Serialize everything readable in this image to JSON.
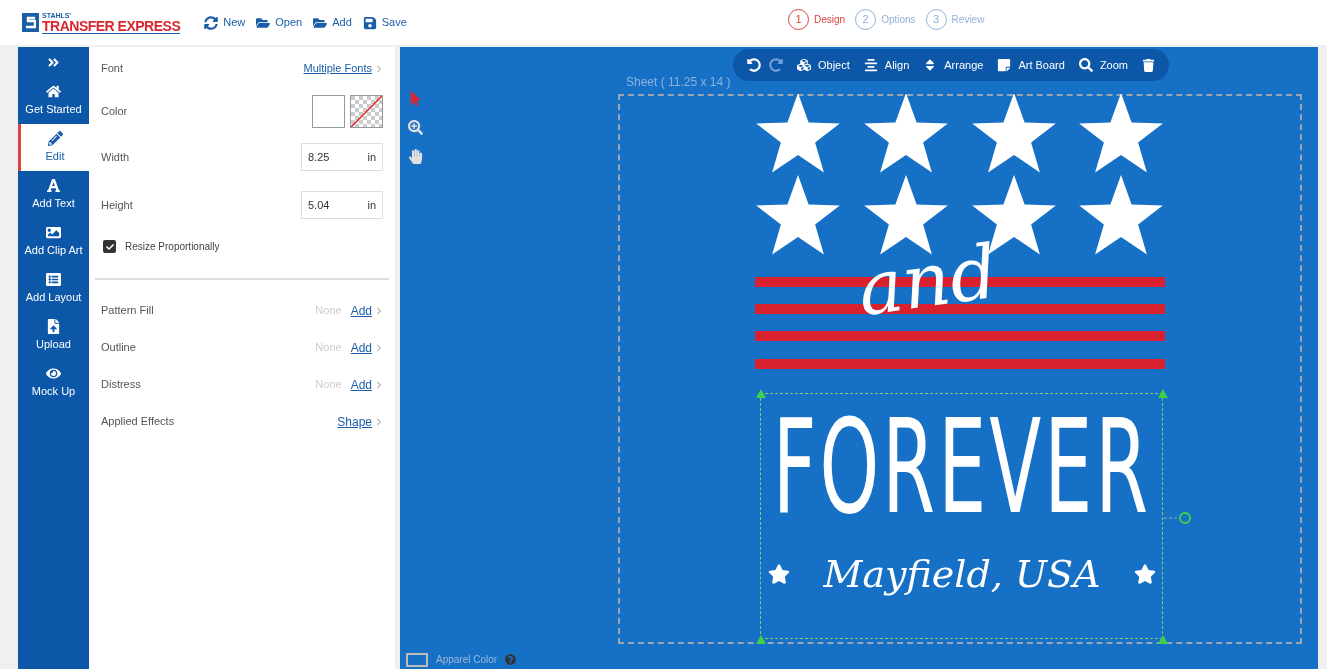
{
  "header": {
    "logo": {
      "top": "STAHLS'",
      "main": "TRANSFER EXPRESS"
    },
    "actions": [
      {
        "kind": "new",
        "label": "New"
      },
      {
        "kind": "open",
        "label": "Open"
      },
      {
        "kind": "add",
        "label": "Add"
      },
      {
        "kind": "save",
        "label": "Save"
      }
    ],
    "steps": [
      {
        "number": "1",
        "label": "Design",
        "selected": true
      },
      {
        "number": "2",
        "label": "Options",
        "selected": false
      },
      {
        "number": "3",
        "label": "Review",
        "selected": false
      }
    ]
  },
  "sidebar": {
    "items": [
      {
        "kind": "home",
        "label": "Get Started",
        "selected": false
      },
      {
        "kind": "edit",
        "label": "Edit",
        "selected": true
      },
      {
        "kind": "text",
        "label": "Add Text",
        "selected": false
      },
      {
        "kind": "image",
        "label": "Add Clip Art",
        "selected": false
      },
      {
        "kind": "layout",
        "label": "Add Layout",
        "selected": false
      },
      {
        "kind": "upload",
        "label": "Upload",
        "selected": false
      },
      {
        "kind": "eye",
        "label": "Mock Up",
        "selected": false
      }
    ]
  },
  "panel": {
    "font": {
      "label": "Font",
      "value": "Multiple Fonts"
    },
    "color": {
      "label": "Color"
    },
    "width": {
      "label": "Width",
      "value": "8.25",
      "unit": "in"
    },
    "height": {
      "label": "Height",
      "value": "5.04",
      "unit": "in"
    },
    "resize": {
      "label": "Resize Proportionally",
      "checked": true
    },
    "effects": [
      {
        "label": "Pattern Fill",
        "value": "None",
        "action": "Add"
      },
      {
        "label": "Outline",
        "value": "None",
        "action": "Add"
      },
      {
        "label": "Distress",
        "value": "None",
        "action": "Add"
      },
      {
        "label": "Applied Effects",
        "action": "Shape"
      }
    ]
  },
  "canvas": {
    "toolbar": [
      {
        "kind": "object",
        "label": "Object"
      },
      {
        "kind": "align",
        "label": "Align"
      },
      {
        "kind": "arrange",
        "label": "Arrange"
      },
      {
        "kind": "artboard",
        "label": "Art Board"
      },
      {
        "kind": "zoom",
        "label": "Zoom"
      }
    ],
    "sheet_label": "Sheet ( 11.25 x 14 )",
    "design": {
      "word_1": "and",
      "word_2": "FOREVER",
      "word_3": "Mayfield, USA"
    },
    "apparel_color": "Apparel Color"
  }
}
